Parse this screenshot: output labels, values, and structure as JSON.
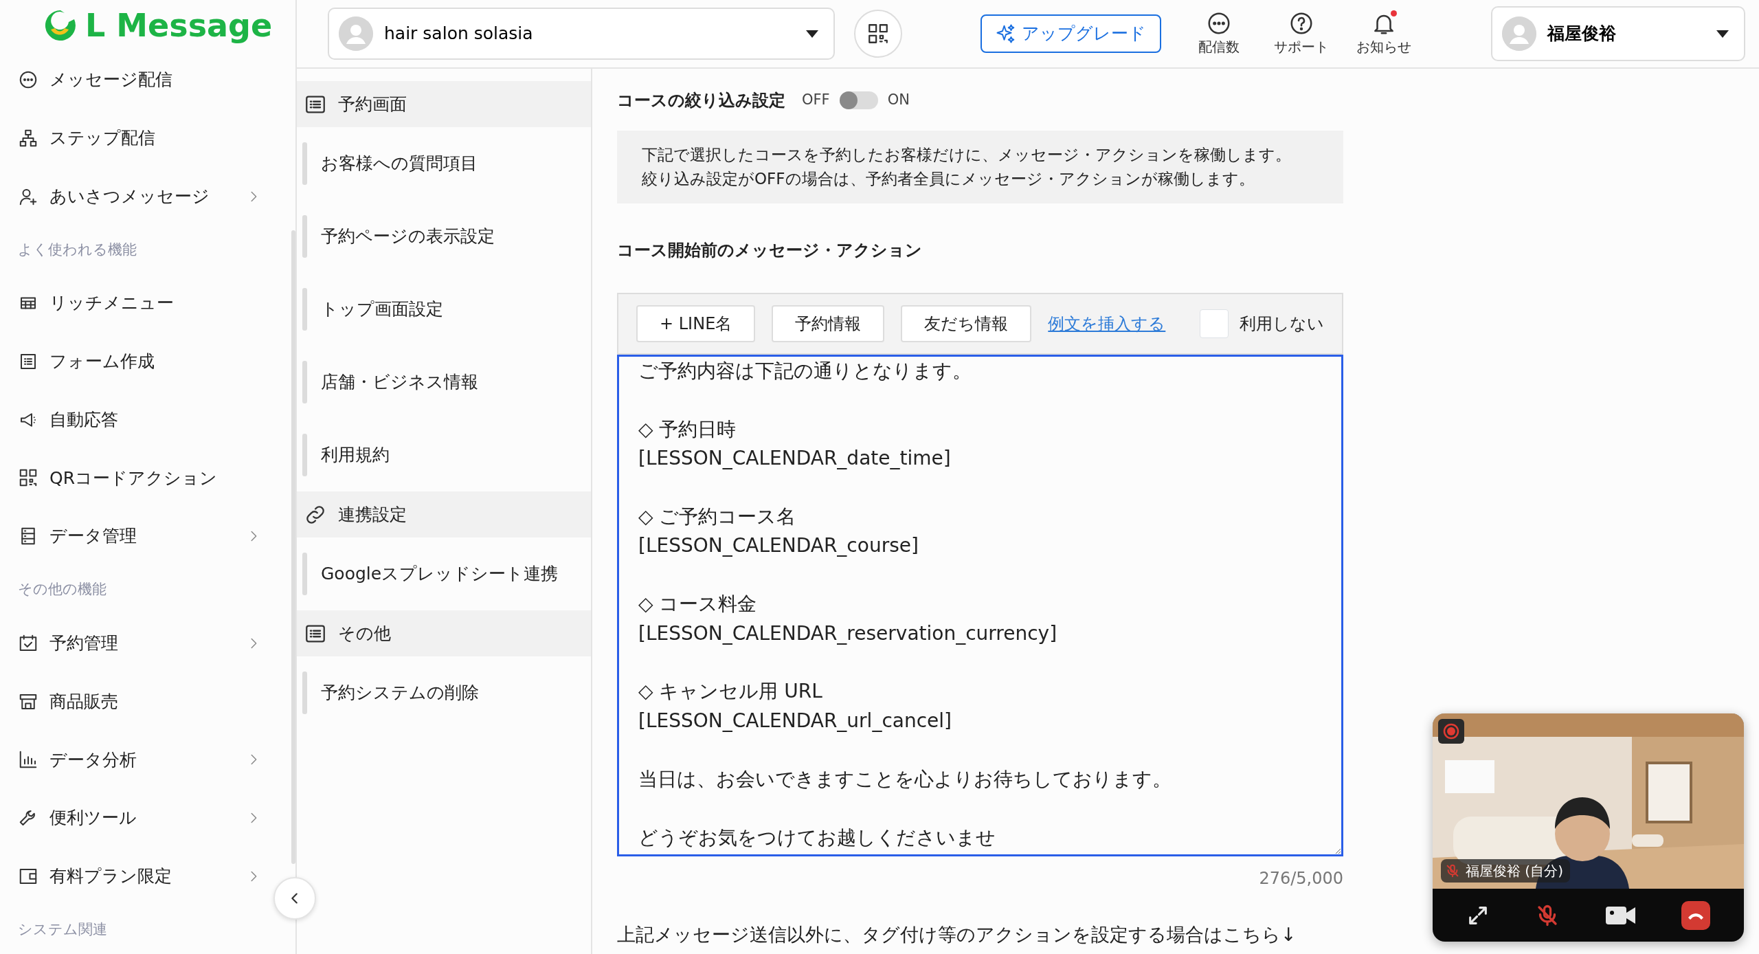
{
  "header": {
    "logo": "L Message",
    "account": "hair salon solasia",
    "upgrade": "アップグレード",
    "actions": [
      {
        "label": "配信数",
        "kind": "count"
      },
      {
        "label": "サポート",
        "kind": "support"
      },
      {
        "label": "お知らせ",
        "kind": "notice",
        "unread": true
      }
    ],
    "user": "福屋俊裕"
  },
  "sidebar": {
    "items": [
      {
        "kind": "item",
        "label": "メッセージ配信",
        "submenu": false
      },
      {
        "kind": "item",
        "label": "ステップ配信",
        "submenu": false
      },
      {
        "kind": "item",
        "label": "あいさつメッセージ",
        "submenu": true
      },
      {
        "kind": "heading",
        "label": "よく使われる機能"
      },
      {
        "kind": "item",
        "label": "リッチメニュー",
        "submenu": false
      },
      {
        "kind": "item",
        "label": "フォーム作成",
        "submenu": false
      },
      {
        "kind": "item",
        "label": "自動応答",
        "submenu": false
      },
      {
        "kind": "item",
        "label": "QRコードアクション",
        "submenu": false
      },
      {
        "kind": "item",
        "label": "データ管理",
        "submenu": true
      },
      {
        "kind": "heading",
        "label": "その他の機能"
      },
      {
        "kind": "item",
        "label": "予約管理",
        "submenu": true
      },
      {
        "kind": "item",
        "label": "商品販売",
        "submenu": false
      },
      {
        "kind": "item",
        "label": "データ分析",
        "submenu": true
      },
      {
        "kind": "item",
        "label": "便利ツール",
        "submenu": true
      },
      {
        "kind": "item",
        "label": "有料プラン限定",
        "submenu": true
      },
      {
        "kind": "heading",
        "label": "システム関連"
      }
    ]
  },
  "submenu": {
    "sections": [
      {
        "label": "予約画面",
        "items": [
          "お客様への質問項目",
          "予約ページの表示設定",
          "トップ画面設定",
          "店舗・ビジネス情報",
          "利用規約"
        ]
      },
      {
        "label": "連携設定",
        "items": [
          "Googleスプレッドシート連携"
        ]
      },
      {
        "label": "その他",
        "items": [
          "予約システムの削除"
        ]
      }
    ]
  },
  "content": {
    "filter": {
      "label": "コースの絞り込み設定",
      "off_label": "OFF",
      "on_label": "ON",
      "on": false
    },
    "info": [
      "下記で選択したコースを予約したお客様だけに、メッセージ・アクションを稼働します。",
      "絞り込み設定がOFFの場合は、予約者全員にメッセージ・アクションが稼働します。"
    ],
    "section_title": "コース開始前のメッセージ・アクション",
    "toolbar": {
      "buttons": [
        "+ LINE名",
        "予約情報",
        "友だち情報"
      ],
      "link": "例文を挿入する",
      "disable": {
        "label": "利用しない",
        "checked": false
      }
    },
    "message": [
      [
        "ご予約内容は下記の通りとなります。"
      ],
      [
        "◇ 予約日時",
        "[LESSON_CALENDAR_date_time]"
      ],
      [
        "◇ ご予約コース名",
        "[LESSON_CALENDAR_course]"
      ],
      [
        "◇ コース料金",
        "[LESSON_CALENDAR_reservation_currency]"
      ],
      [
        "◇ キャンセル用 URL",
        "[LESSON_CALENDAR_url_cancel]"
      ],
      [
        "当日は、お会いできますことを心よりお待ちしております。"
      ],
      [
        "どうぞお気をつけてお越しくださいませ"
      ]
    ],
    "counter": "276/5,000",
    "footer_note": "上記メッセージ送信以外に、タグ付け等のアクションを設定する場合はこちら↓"
  },
  "video_call": {
    "kind": "picture",
    "name": "福屋俊裕 (自分)",
    "muted": true
  }
}
